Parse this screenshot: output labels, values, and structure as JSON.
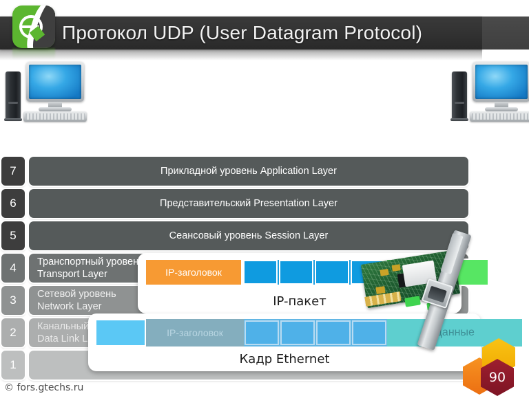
{
  "slide": {
    "title": "Протокол UDP (User Datagram Protocol)",
    "page_number": "90",
    "footer": "© fors.gtechs.ru",
    "logo_letter": "e"
  },
  "colors": {
    "title_bar": "#333333",
    "title_text": "#f2f2f2",
    "logo_green": "#5cb630",
    "logo_dark": "#3f3f3f",
    "ip_header_orange": "#f79a33",
    "packet_blue": "#1a9ee0",
    "green_tail": "#57e663",
    "eth_header_blue": "#5bc8f5",
    "data_teal": "#5ecfcf",
    "hex_yellow": "#f9c315",
    "hex_orange": "#f79321",
    "hex_red": "#9e1f2f"
  },
  "osi_stack": {
    "layers": [
      {
        "number": "7",
        "line1": "Прикладной уровень Application Layer",
        "line2": "",
        "align": "center",
        "bar_color": "#555a5a",
        "num_color": "#3d3d3d",
        "text_color": "#ffffff"
      },
      {
        "number": "6",
        "line1": "Представительский  Presentation Layer",
        "line2": "",
        "align": "center",
        "bar_color": "#555a5a",
        "num_color": "#3d3d3d",
        "text_color": "#ffffff"
      },
      {
        "number": "5",
        "line1": "Сеансовый уровень Session Layer",
        "line2": "",
        "align": "center",
        "bar_color": "#555a5a",
        "num_color": "#3d3d3d",
        "text_color": "#ffffff"
      },
      {
        "number": "4",
        "line1": "Транспортный уровень",
        "line2": "Transport Layer",
        "align": "left",
        "bar_color": "#6e7272",
        "num_color": "#6e7272",
        "text_color": "#ffffff"
      },
      {
        "number": "3",
        "line1": "Сетевой уровень",
        "line2": "Network Layer",
        "align": "left",
        "bar_color": "#8f9292",
        "num_color": "#8f9292",
        "text_color": "#f2f2f2"
      },
      {
        "number": "2",
        "line1": "Канальный уровень",
        "line2": "Data Link Layer",
        "align": "left",
        "bar_color": "#acaeae",
        "num_color": "#acaeae",
        "text_color": "#e8e8e8"
      },
      {
        "number": "1",
        "line1": "",
        "line2": "",
        "align": "left",
        "bar_color": "#bdbfbf",
        "num_color": "#bdbfbf",
        "text_color": "#d8d8d8"
      }
    ]
  },
  "ip_packet_panel": {
    "label": "IP-пакет",
    "header_label": "IP-заголовок",
    "cell_count": 4
  },
  "ethernet_panel": {
    "label": "Кадр Ethernet",
    "eth_header_label": "",
    "ghost_ip_header_label": "IP-заголовок",
    "data_label": "Данные",
    "cell_count": 4
  },
  "devices": {
    "left_computer_name": "desktop-computer-left",
    "right_computer_name": "desktop-computer-right",
    "nic_name": "network-interface-card"
  }
}
